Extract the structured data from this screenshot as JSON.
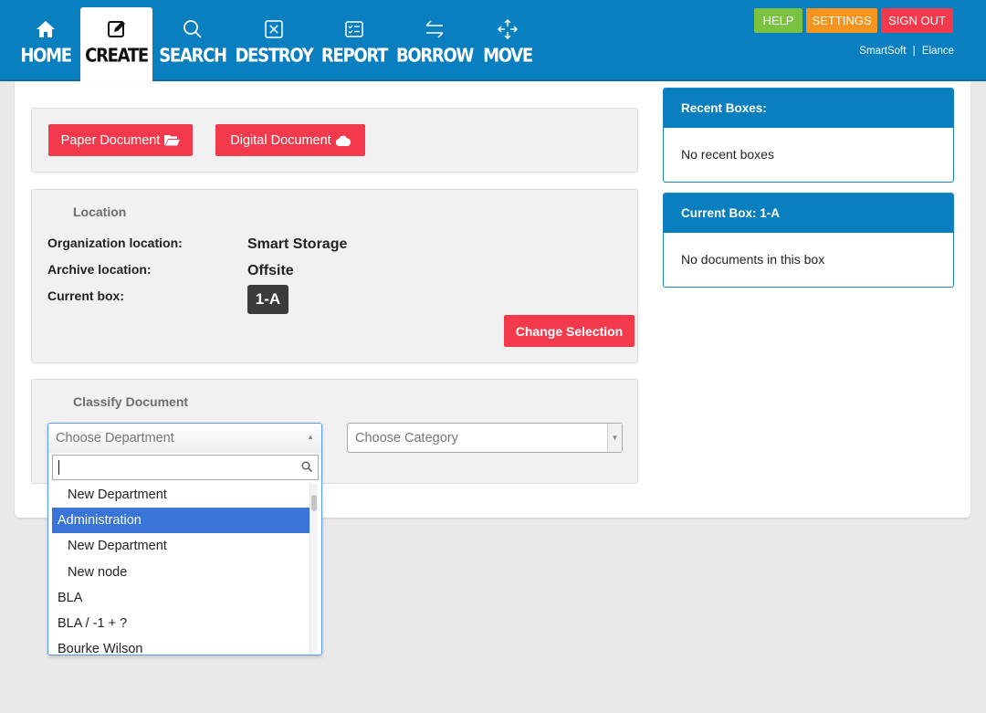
{
  "nav": {
    "items": [
      {
        "label": "HOME",
        "icon": "home-icon"
      },
      {
        "label": "CREATE",
        "icon": "edit-icon"
      },
      {
        "label": "SEARCH",
        "icon": "search-icon"
      },
      {
        "label": "DESTROY",
        "icon": "destroy-x-icon"
      },
      {
        "label": "REPORT",
        "icon": "report-icon"
      },
      {
        "label": "BORROW",
        "icon": "swap-arrows-icon"
      },
      {
        "label": "MOVE",
        "icon": "move-arrows-icon"
      }
    ],
    "active": "CREATE"
  },
  "top_buttons": {
    "help": "HELP",
    "settings": "SETTINGS",
    "sign_out": "SIGN OUT"
  },
  "user": {
    "org": "SmartSoft",
    "separator": "|",
    "name": "Elance"
  },
  "document_type": {
    "paper_label": "Paper Document",
    "paper_icon": "folder-open-icon",
    "digital_label": "Digital Document",
    "digital_icon": "cloud-icon"
  },
  "location": {
    "title": "Location",
    "org_label": "Organization location:",
    "org_value": "Smart Storage",
    "archive_label": "Archive location:",
    "archive_value": "Offsite",
    "box_label": "Current box:",
    "box_value": "1-A",
    "change_button": "Change Selection"
  },
  "classify": {
    "title": "Classify Document",
    "department_placeholder": "Choose Department",
    "category_placeholder": "Choose Category",
    "search_value": "",
    "options": [
      {
        "label": "New Department",
        "indent": true,
        "highlighted": false
      },
      {
        "label": "Administration",
        "indent": false,
        "highlighted": true
      },
      {
        "label": "New Department",
        "indent": true,
        "highlighted": false
      },
      {
        "label": "New node",
        "indent": true,
        "highlighted": false
      },
      {
        "label": "BLA",
        "indent": false,
        "highlighted": false
      },
      {
        "label": "BLA / -1 + ?",
        "indent": false,
        "highlighted": false
      },
      {
        "label": "Bourke Wilson",
        "indent": false,
        "highlighted": false
      }
    ]
  },
  "recent_boxes": {
    "title": "Recent Boxes:",
    "empty": "No recent boxes"
  },
  "current_box": {
    "title": "Current Box: 1-A",
    "empty": "No documents in this box"
  },
  "colors": {
    "brand_blue": "#0a7fbf",
    "help_green": "#7bc142",
    "settings_orange": "#f7941d",
    "signout_red": "#f23a4c",
    "action_red": "#f23a4c",
    "highlight_blue": "#3875d7"
  }
}
